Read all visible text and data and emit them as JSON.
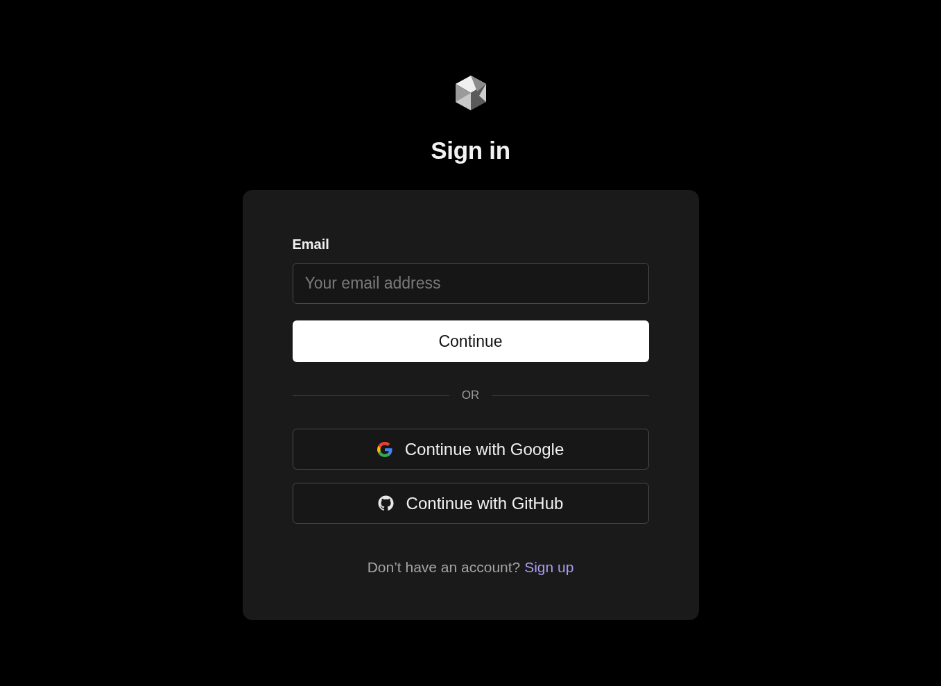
{
  "title": "Sign in",
  "form": {
    "email_label": "Email",
    "email_placeholder": "Your email address",
    "submit": "Continue"
  },
  "divider": "OR",
  "providers": [
    {
      "kind": "google",
      "label": "Continue with Google"
    },
    {
      "kind": "github",
      "label": "Continue with GitHub"
    }
  ],
  "footer": {
    "prompt": "Don’t have an account?",
    "link": "Sign up"
  }
}
